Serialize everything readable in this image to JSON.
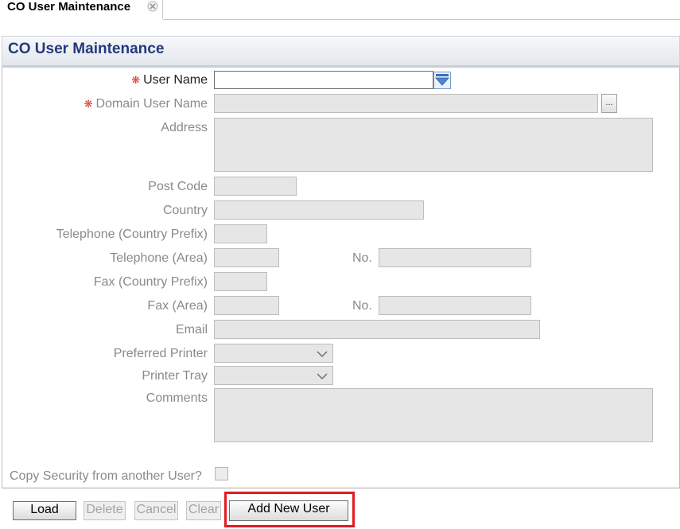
{
  "tab": {
    "label": "CO User Maintenance"
  },
  "panel": {
    "title": "CO User Maintenance"
  },
  "form": {
    "user_name_label": "User Name",
    "user_name_value": "",
    "domain_user_name_label": "Domain User Name",
    "domain_lookup_label": "...",
    "address_label": "Address",
    "post_code_label": "Post Code",
    "country_label": "Country",
    "telephone_prefix_label": "Telephone (Country Prefix)",
    "telephone_area_label": "Telephone (Area)",
    "telephone_no_label": "No.",
    "fax_prefix_label": "Fax (Country Prefix)",
    "fax_area_label": "Fax (Area)",
    "fax_no_label": "No.",
    "email_label": "Email",
    "preferred_printer_label": "Preferred Printer",
    "printer_tray_label": "Printer Tray",
    "comments_label": "Comments",
    "copy_security_label": "Copy Security from another User?"
  },
  "buttons": {
    "load": "Load",
    "delete": "Delete",
    "cancel": "Cancel",
    "clear": "Clear",
    "add_new_user": "Add New User"
  },
  "colors": {
    "title": "#233a7d",
    "required": "#e0302a",
    "highlight": "#e21a23"
  }
}
